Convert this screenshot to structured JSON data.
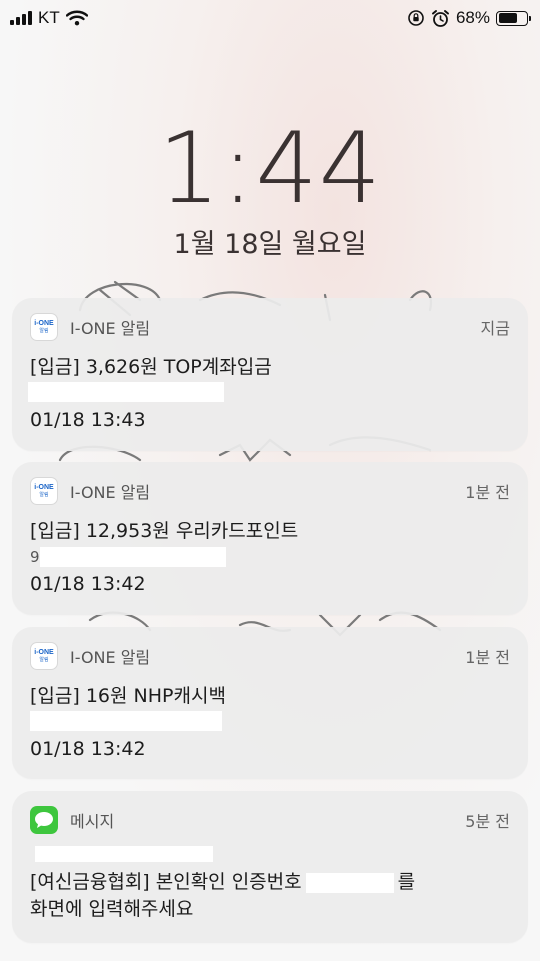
{
  "status_bar": {
    "carrier": "KT",
    "battery_percent": "68%",
    "battery_level": 0.68,
    "icons": [
      "signal-icon",
      "wifi-icon",
      "orientation-lock-icon",
      "alarm-icon",
      "battery-icon"
    ]
  },
  "lock_screen": {
    "time": "1:44",
    "date": "1월 18일 월요일"
  },
  "notifications": [
    {
      "app": "I-ONE 알림",
      "icon_text_top": "i-ONE",
      "icon_text_bottom": "알림",
      "time_ago": "지금",
      "line1": "[입금] 3,626원 TOP계좌입금",
      "timestamp": "01/18 13:43"
    },
    {
      "app": "I-ONE 알림",
      "icon_text_top": "i-ONE",
      "icon_text_bottom": "알림",
      "time_ago": "1분 전",
      "line1": "[입금] 12,953원 우리카드포인트",
      "line2_prefix": "9",
      "timestamp": "01/18 13:42"
    },
    {
      "app": "I-ONE 알림",
      "icon_text_top": "i-ONE",
      "icon_text_bottom": "알림",
      "time_ago": "1분 전",
      "line1": "[입금] 16원 NHP캐시백",
      "timestamp": "01/18 13:42"
    },
    {
      "app": "메시지",
      "time_ago": "5분 전",
      "line1_prefix": "[여신금융협회] 본인확인 인증번호",
      "line1_suffix": "를",
      "line2": "화면에 입력해주세요"
    }
  ],
  "colors": {
    "message_icon": "#3ec63e",
    "ione_brand": "#1a64c8"
  }
}
